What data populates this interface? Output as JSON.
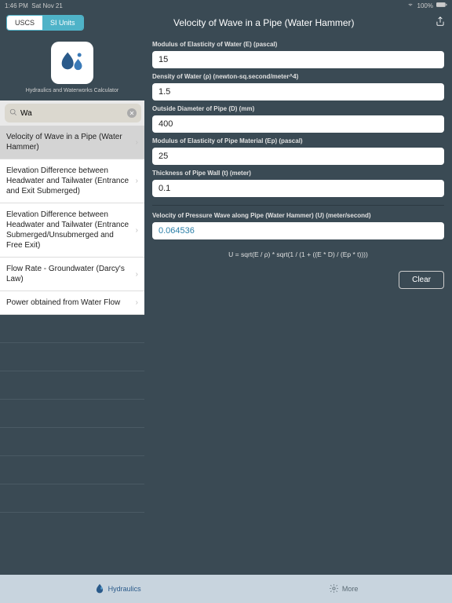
{
  "status": {
    "time": "1:46 PM",
    "date": "Sat Nov 21",
    "battery": "100%"
  },
  "header": {
    "seg_left": "USCS",
    "seg_right": "SI Units",
    "title": "Velocity of Wave in a Pipe (Water Hammer)"
  },
  "sidebar": {
    "caption": "Hydraulics and Waterworks Calculator",
    "search_value": "Wa",
    "cancel": "Cancel",
    "items": [
      "Velocity of Wave in a Pipe (Water Hammer)",
      "Elevation Difference between Headwater and Tailwater (Entrance and Exit Submerged)",
      "Elevation Difference between Headwater and Tailwater (Entrance Submerged/Unsubmerged and Free Exit)",
      "Flow Rate - Groundwater (Darcy's Law)",
      "Power obtained from Water Flow"
    ]
  },
  "fields": [
    {
      "label": "Modulus of Elasticity of Water (E) (pascal)",
      "value": "15"
    },
    {
      "label": "Density of Water (ρ) (newton-sq.second/meter^4)",
      "value": "1.5"
    },
    {
      "label": "Outside Diameter of Pipe (D) (mm)",
      "value": "400"
    },
    {
      "label": "Modulus of Elasticity of Pipe Material (Ep) (pascal)",
      "value": "25"
    },
    {
      "label": "Thickness of Pipe Wall (t) (meter)",
      "value": "0.1"
    }
  ],
  "result": {
    "label": "Velocity of Pressure Wave along Pipe (Water Hammer) (U) (meter/second)",
    "value": "0.064536"
  },
  "formula": "U = sqrt(E / ρ) *  sqrt(1 / (1 + ((E * D) / (Ep * t))))",
  "clear": "Clear",
  "tabbar": {
    "hydraulics": "Hydraulics",
    "more": "More"
  }
}
